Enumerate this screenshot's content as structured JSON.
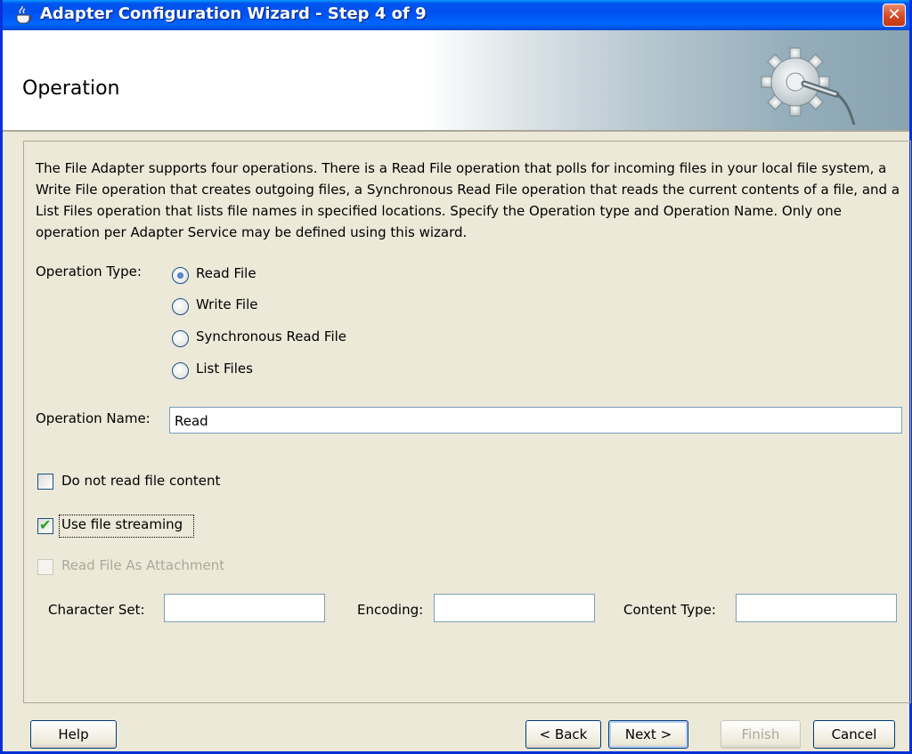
{
  "window": {
    "title": "Adapter Configuration Wizard - Step 4 of 9",
    "close_glyph": "✕"
  },
  "header": {
    "title": "Operation",
    "banner_icon": "gear-plug-icon"
  },
  "description": "The File Adapter supports four operations.  There is a Read File operation that polls for incoming files in your local file system, a Write File operation that creates outgoing files, a Synchronous Read File operation that reads the current contents of a file, and a List Files operation that lists file names in specified locations.  Specify the Operation type and Operation Name.  Only one operation per Adapter Service may be defined using this wizard.",
  "operation_type": {
    "label": "Operation Type:",
    "options": [
      {
        "label": "Read File",
        "checked": true
      },
      {
        "label": "Write File",
        "checked": false
      },
      {
        "label": "Synchronous Read File",
        "checked": false
      },
      {
        "label": "List Files",
        "checked": false
      }
    ]
  },
  "operation_name": {
    "label": "Operation Name:",
    "value": "Read"
  },
  "options": {
    "do_not_read": {
      "label": "Do not read file content",
      "checked": false
    },
    "use_streaming": {
      "label": "Use file streaming",
      "checked": true
    },
    "read_as_attachment": {
      "label": "Read File As Attachment",
      "checked": false,
      "disabled": true
    }
  },
  "attachment_fields": {
    "character_set": {
      "label": "Character Set:",
      "value": ""
    },
    "encoding": {
      "label": "Encoding:",
      "value": ""
    },
    "content_type": {
      "label": "Content Type:",
      "value": ""
    }
  },
  "buttons": {
    "help": "Help",
    "back": "< Back",
    "next": "Next >",
    "finish": "Finish",
    "cancel": "Cancel"
  },
  "colors": {
    "title_bar": "#0053ee",
    "dialog_bg": "#ece9d8",
    "radio_accent": "#2c5bbf",
    "check_accent": "#21a121"
  }
}
